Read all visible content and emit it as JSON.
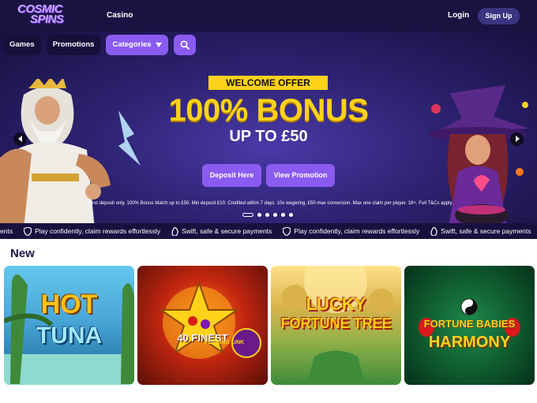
{
  "header": {
    "logo_line1": "COSMIC",
    "logo_line2": "SPINS",
    "nav_casino": "Casino",
    "login_label": "Login",
    "signup_label": "Sign Up"
  },
  "subnav": {
    "games_label": "Games",
    "promotions_label": "Promotions",
    "categories_label": "Categories",
    "search_icon": "search-icon"
  },
  "hero": {
    "badge": "WELCOME OFFER",
    "headline": "100% BONUS",
    "subheadline": "UP TO £50",
    "deposit_button": "Deposit Here",
    "promotion_button": "View Promotion",
    "terms": "First deposit only. 100% Bonus Match up to £50. Min deposit £10. Credited within 7 days. 10x wagering, £50 max conversion. Max one claim per player. 18+. Full T&Cs apply.",
    "slides_total": 6,
    "active_slide": 1
  },
  "ticker": {
    "items": [
      {
        "text": "ents",
        "icon": ""
      },
      {
        "text": "Play confidently, claim rewards effortlessly",
        "icon": "shield-icon"
      },
      {
        "text": "Swift, safe & secure payments",
        "icon": "flame-icon"
      },
      {
        "text": "Play confidently, claim rewards effortlessly",
        "icon": "shield-icon"
      },
      {
        "text": "Swift, safe & secure payments",
        "icon": "flame-icon"
      }
    ]
  },
  "section": {
    "title": "New"
  },
  "games": [
    {
      "title_line1": "HOT",
      "title_line2": "TUNA"
    },
    {
      "title_line1": "40 FINEST",
      "title_line2": "FLAMING LINK"
    },
    {
      "title_line1": "LUCKY",
      "title_line2": "FORTUNE TREE"
    },
    {
      "title_line1": "FORTUNE BABIES",
      "title_line2": "HARMONY"
    }
  ],
  "colors": {
    "header_bg": "#1a1342",
    "accent_purple": "#8a5bf0",
    "offer_yellow": "#ffd21a"
  }
}
